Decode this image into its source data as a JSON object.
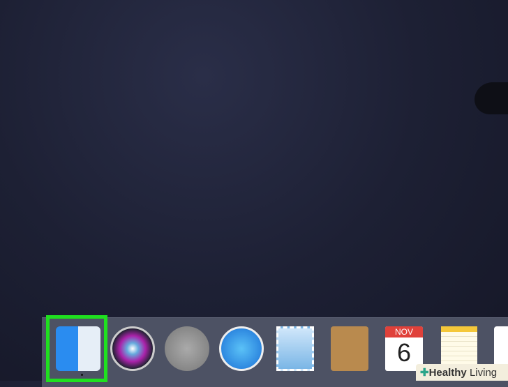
{
  "dock": {
    "apps": [
      {
        "name": "Finder",
        "icon": "finder-icon"
      },
      {
        "name": "Siri",
        "icon": "siri-icon"
      },
      {
        "name": "Launchpad",
        "icon": "launchpad-icon"
      },
      {
        "name": "Safari",
        "icon": "safari-icon"
      },
      {
        "name": "Mail",
        "icon": "mail-icon"
      },
      {
        "name": "Contacts",
        "icon": "contacts-icon"
      },
      {
        "name": "Calendar",
        "icon": "calendar-icon",
        "month": "NOV",
        "day": "6"
      },
      {
        "name": "Notes",
        "icon": "notes-icon"
      },
      {
        "name": "Reminders",
        "icon": "reminders-icon"
      }
    ],
    "highlight_color": "#1fe01f"
  },
  "watermark": {
    "bold": "Healthy",
    "light": "Living"
  }
}
